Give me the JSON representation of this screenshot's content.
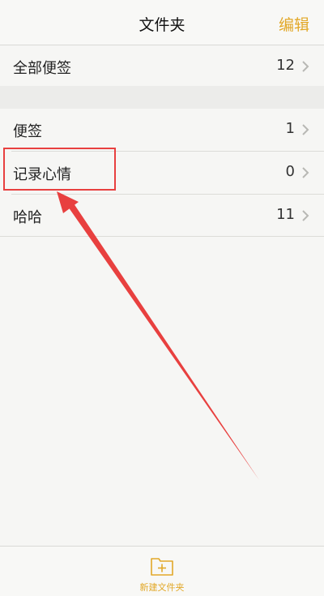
{
  "nav": {
    "title": "文件夹",
    "edit_label": "编辑"
  },
  "all_notes": {
    "label": "全部便签",
    "count": "12"
  },
  "folders": [
    {
      "label": "便签",
      "count": "1"
    },
    {
      "label": "记录心情",
      "count": "0"
    },
    {
      "label": "哈哈",
      "count": "11"
    }
  ],
  "toolbar": {
    "new_folder_label": "新建文件夹",
    "new_folder_icon": "folder-plus-icon"
  },
  "colors": {
    "accent": "#e2a828",
    "annotation": "#e8403f"
  }
}
